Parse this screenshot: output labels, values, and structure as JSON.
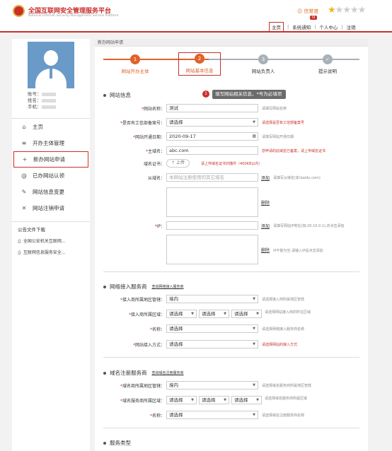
{
  "header": {
    "site_title": "全国互联网安全管理服务平台",
    "site_subtitle": "National Internet Security Management Service Platform",
    "credit_label": "信誉度",
    "credit_badge": "III",
    "nav": [
      "主页",
      "系统通知",
      "个人中心",
      "注销"
    ],
    "rating": {
      "value": 1,
      "max": 5
    }
  },
  "account": {
    "account_label": "账号：",
    "name_label": "姓名：",
    "phone_label": "手机："
  },
  "sidebar": {
    "items": [
      {
        "label": "主页",
        "icon": "home-icon"
      },
      {
        "label": "开办主体管理",
        "icon": "list-icon"
      },
      {
        "label": "新办网站申请",
        "icon": "plus-icon"
      },
      {
        "label": "已办网站认领",
        "icon": "at-icon"
      },
      {
        "label": "网站信息变更",
        "icon": "edit-icon"
      },
      {
        "label": "网站注销申请",
        "icon": "close-icon"
      }
    ],
    "notices_title": "公告文件下载",
    "notices": [
      "全国公安机关互联网...",
      "互联网信息服务安全..."
    ]
  },
  "main": {
    "breadcrumb": "新办网站申请",
    "steps": [
      {
        "num": "1",
        "label": "网站开办主体",
        "state": "done"
      },
      {
        "num": "2",
        "label": "网站基本信息",
        "state": "current"
      },
      {
        "num": "3",
        "label": "网站负责人",
        "state": "todo"
      },
      {
        "num": "✓",
        "label": "提示说明",
        "state": "todo"
      }
    ],
    "site_section": {
      "title": "网站信息",
      "tooltip_num": "1",
      "tooltip": "填写网站相关信息，*号为必填项",
      "name_label": "网站名称：",
      "name_value": "测试",
      "name_hint": "请填写网站名称",
      "icp_label": "是否有工信部备案号：",
      "icp_value": "请选择",
      "icp_hint": "请选择是否有工信部备案号",
      "date_label": "网站开通日期：",
      "date_value": "2020-09-17",
      "date_hint": "请填写网站开通日期",
      "domain_label": "主域名：",
      "domain_value": "abc.com",
      "domain_hint": "您申请的此域名已备案，请上传域名证书",
      "cert_label": "域名证书：",
      "upload_label": "上传",
      "cert_hint": "请上传域名证书扫描件（400KB以内）",
      "sub_label": "从域名：",
      "sub_placeholder": "本网站注册使用的其它域名",
      "add_label": "添加",
      "sub_hint": "请填写从域名(如:baidu.com)",
      "delete_label": "删除",
      "ip_label": "IP：",
      "ip_hint": "请填写网站IP地址(如:20.10.0.1),并点击添加",
      "ip_delete_hint": "IP不能为空,请输入IP后点击添加"
    },
    "access_section": {
      "title": "网络接入服务商",
      "link": "查询网络接入服务商",
      "region_label": "接入商所属地区管辖：",
      "region_value": "境内",
      "region_hint": "请选择接入商所属地区管辖",
      "area_label": "接入商所属区域：",
      "select_placeholder": "请选择",
      "area_hint": "请选择网站接入商的所在区域",
      "name_label": "名称：",
      "name_value": "请选择",
      "name_hint": "请选择网络接入服务商名称",
      "mode_label": "网站接入方式：",
      "mode_value": "请选择",
      "mode_hint": "请选择网站的接入方式"
    },
    "registrar_section": {
      "title": "域名注册服务商",
      "link": "查询域名注册服务商",
      "region_label": "域名商所属地区管辖：",
      "region_value": "境内",
      "region_hint": "请选择域名服务商所属地区管辖",
      "area_label": "域名服务商所属区域：",
      "area_hint": "请选择域名服务商所属区域",
      "name_label": "名称：",
      "name_value": "请选择",
      "name_hint": "请选择域名注册服务商名称"
    },
    "service_section": {
      "title": "服务类型"
    }
  },
  "colors": {
    "accent": "#c9302c",
    "step_done": "#e0622a",
    "step_todo": "#a9b0b8"
  }
}
